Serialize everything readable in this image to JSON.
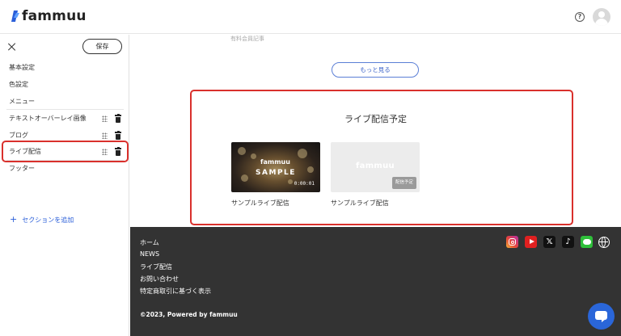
{
  "app": {
    "logo_text": "fammuu"
  },
  "header": {
    "help_icon": "?"
  },
  "sidebar": {
    "save_label": "保存",
    "items": [
      {
        "label": "基本設定"
      },
      {
        "label": "色設定"
      },
      {
        "label": "メニュー"
      },
      {
        "label": "テキストオーバーレイ画像"
      },
      {
        "label": "ブログ"
      },
      {
        "label": "ライブ配信"
      },
      {
        "label": "フッター"
      }
    ],
    "add_section_label": "セクションを追加"
  },
  "main": {
    "paid_articles_label": "有料会員記事",
    "more_button_label": "もっと見る",
    "live_section": {
      "title": "ライブ配信予定",
      "cards": [
        {
          "thumb_logo": "fammuu",
          "thumb_caption": "SAMPLE",
          "duration": "0:00:01",
          "title": "サンプルライブ配信"
        },
        {
          "thumb_logo": "fammuu",
          "badge": "配信予定",
          "title": "サンプルライブ配信"
        }
      ]
    }
  },
  "footer": {
    "links": [
      "ホーム",
      "NEWS",
      "ライブ配信",
      "お問い合わせ",
      "特定商取引に基づく表示"
    ],
    "copyright": "©2023, Powered by fammuu",
    "social_icons": [
      "instagram-icon",
      "youtube-icon",
      "x-icon",
      "tiktok-icon",
      "line-icon",
      "globe-icon"
    ]
  },
  "colors": {
    "accent": "#2b5fd9",
    "highlight": "#d9302c",
    "footer_bg": "#333333",
    "chat_button": "#2a66d9"
  }
}
